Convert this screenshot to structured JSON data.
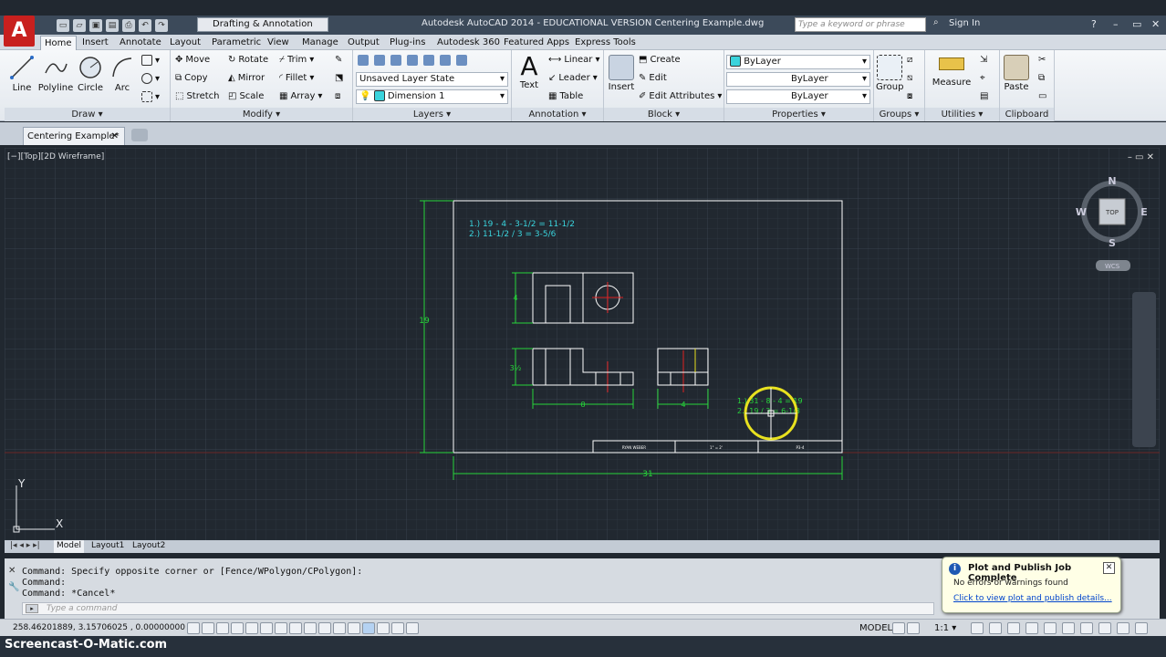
{
  "titlebar": {
    "workspace": "Drafting & Annotation",
    "title": "Autodesk AutoCAD 2014 - EDUCATIONAL VERSION    Centering Example.dwg",
    "search_placeholder": "Type a keyword or phrase",
    "signin": "Sign In",
    "logo": "A"
  },
  "tabs": [
    "Home",
    "Insert",
    "Annotate",
    "Layout",
    "Parametric",
    "View",
    "Manage",
    "Output",
    "Plug-ins",
    "Autodesk 360",
    "Featured Apps",
    "Express Tools"
  ],
  "draw": {
    "title": "Draw",
    "line": "Line",
    "polyline": "Polyline",
    "circle": "Circle",
    "arc": "Arc"
  },
  "modify": {
    "title": "Modify",
    "move": "Move",
    "copy": "Copy",
    "stretch": "Stretch",
    "rotate": "Rotate",
    "mirror": "Mirror",
    "scale": "Scale",
    "trim": "Trim",
    "fillet": "Fillet",
    "array": "Array"
  },
  "layers": {
    "title": "Layers",
    "state": "Unsaved Layer State",
    "current": "Dimension 1"
  },
  "annotation": {
    "title": "Annotation",
    "text": "Text",
    "linear": "Linear",
    "leader": "Leader",
    "table": "Table"
  },
  "block": {
    "title": "Block",
    "insert": "Insert",
    "create": "Create",
    "edit": "Edit",
    "edit_attributes": "Edit Attributes"
  },
  "properties": {
    "title": "Properties",
    "color": "ByLayer",
    "linetype": "ByLayer",
    "lineweight": "ByLayer"
  },
  "groups": {
    "title": "Groups",
    "group": "Group"
  },
  "utilities": {
    "title": "Utilities",
    "measure": "Measure"
  },
  "clipboard": {
    "title": "Clipboard",
    "paste": "Paste"
  },
  "doc_tab": "Centering Example*",
  "viewport_label": "[−][Top][2D Wireframe]",
  "viewcube": {
    "n": "N",
    "s": "S",
    "e": "E",
    "w": "W",
    "top": "TOP",
    "wcs": "WCS"
  },
  "drawing": {
    "notes": [
      "1.) 19 - 4 - 3-1/2 = 11-1/2",
      "2.) 11-1/2 / 3 = 3-5/6"
    ],
    "notes2": [
      "1.) 31 - 8 - 4 = 19",
      "2.) 19 / 3 = 6-1/3"
    ],
    "dim_height": "19",
    "dim_width": "31",
    "dim_4": "4",
    "dim_35": "3½",
    "dim_8": "8",
    "dim_4b": "4",
    "title_block": [
      "RYAN WEBER",
      "1\" = 2'",
      "P3-4"
    ],
    "ucs_y": "Y",
    "ucs_x": "X"
  },
  "layout_tabs": [
    "Model",
    "Layout1",
    "Layout2"
  ],
  "command": {
    "lines": [
      "Command: Specify opposite corner or [Fence/WPolygon/CPolygon]:",
      "Command:",
      "Command: *Cancel*"
    ],
    "placeholder": "Type a command"
  },
  "status": {
    "coords": "258.46201889, 3.15706025 , 0.00000000",
    "model": "MODEL",
    "scale": "1:1"
  },
  "notification": {
    "title": "Plot and Publish Job Complete",
    "message": "No errors or warnings found",
    "link": "Click to view plot and publish details..."
  },
  "watermark": "Screencast-O-Matic.com",
  "colors": {
    "cyan": "#3ad3dc",
    "green": "#27d43a",
    "yellow": "#e8e11f",
    "red": "#e02020",
    "white": "#ffffff"
  }
}
